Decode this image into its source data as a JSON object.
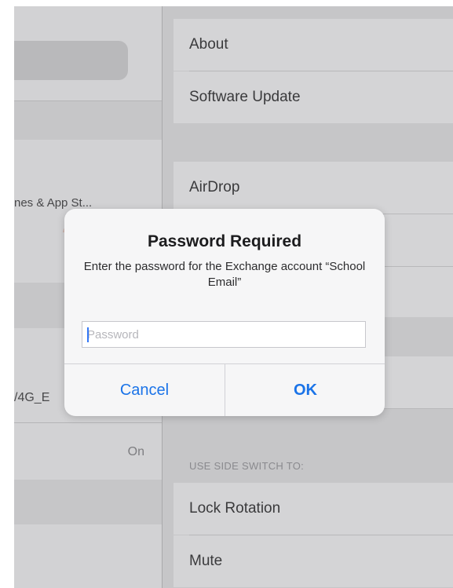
{
  "sidebar": {
    "itunes_label": "nes & App St...",
    "network_label": "/4G_E",
    "toggle_value": "On"
  },
  "detail": {
    "cells": {
      "about": "About",
      "software_update": "Software Update",
      "airdrop": "AirDrop",
      "lock_rotation": "Lock Rotation",
      "mute": "Mute"
    },
    "side_switch_header": "USE SIDE SWITCH TO:"
  },
  "alert": {
    "title": "Password Required",
    "message": "Enter the password for the Exchange account “School Email”",
    "password_placeholder": "Password",
    "password_value": "",
    "cancel_label": "Cancel",
    "ok_label": "OK"
  },
  "colors": {
    "accent": "#1a73e8",
    "dim_background": "#c6c6c8",
    "alert_background": "#f6f6f7"
  }
}
